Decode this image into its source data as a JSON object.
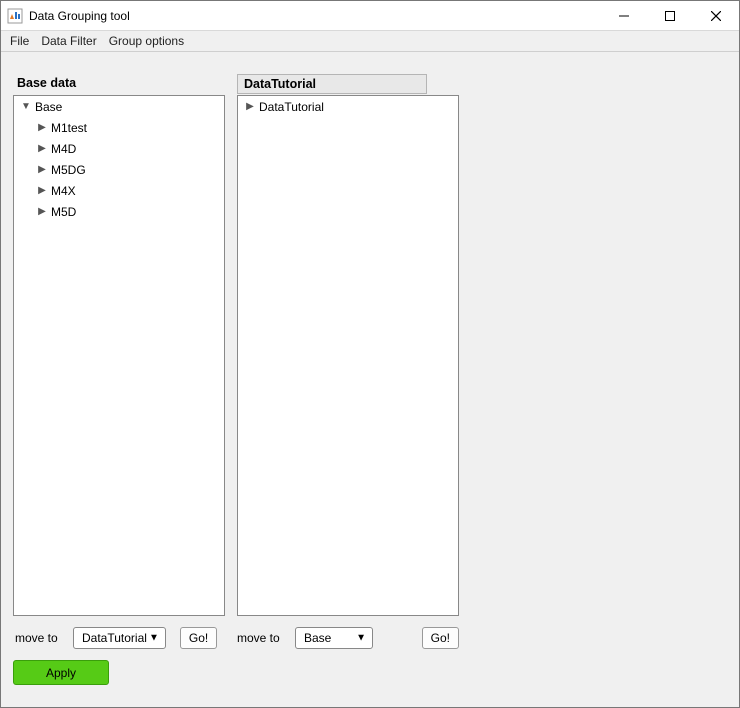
{
  "window": {
    "title": "Data Grouping tool"
  },
  "menu": {
    "file": "File",
    "filter": "Data Filter",
    "group": "Group options"
  },
  "labels": {
    "base": "Base data",
    "tutorial": "DataTutorial"
  },
  "baseTree": {
    "root": "Base",
    "items": [
      "M1test",
      "M4D",
      "M5DG",
      "M4X",
      "M5D"
    ]
  },
  "tutTree": {
    "root": "DataTutorial"
  },
  "moveLeft": {
    "label": "move to",
    "select": "DataTutorial",
    "go": "Go!"
  },
  "moveRight": {
    "label": "move to",
    "select": "Base",
    "go": "Go!"
  },
  "apply": "Apply"
}
